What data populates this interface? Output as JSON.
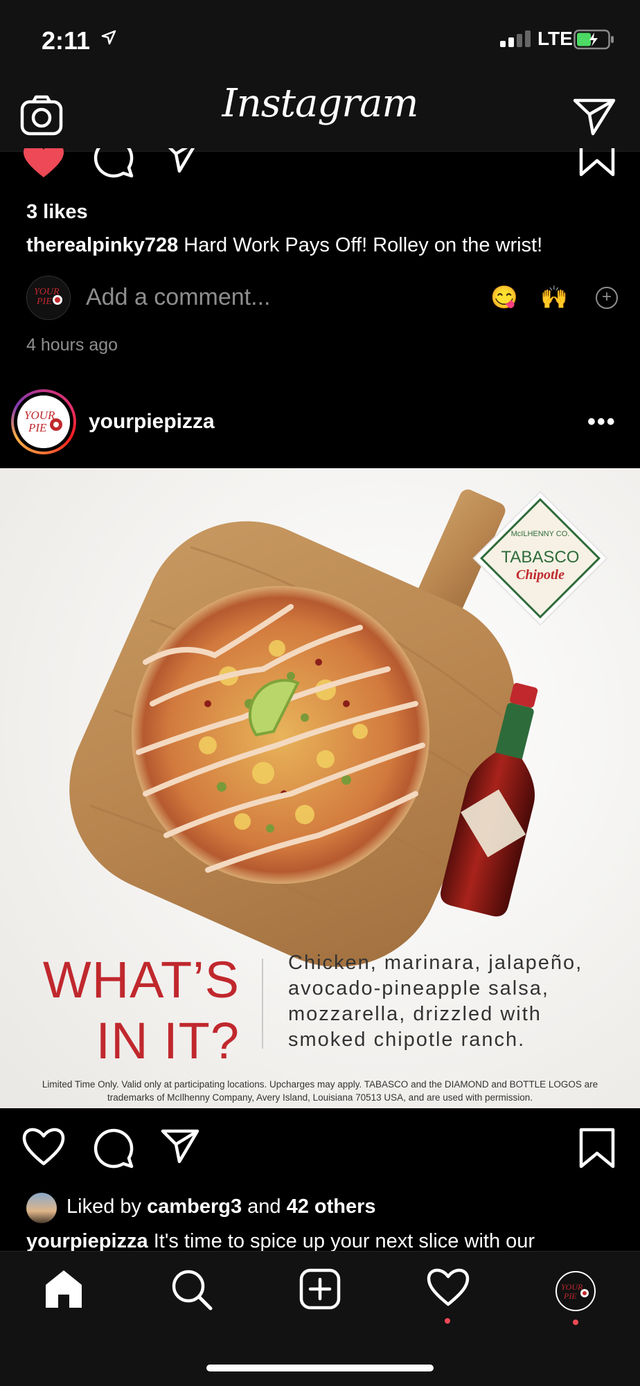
{
  "status": {
    "time": "2:11",
    "network": "LTE"
  },
  "header": {
    "title": "Instagram"
  },
  "prev_post": {
    "likes": "3 likes",
    "username": "therealpinky728",
    "caption": "Hard Work Pays Off! Rolley on the wrist!",
    "comment_placeholder": "Add a comment...",
    "quick_emojis": [
      "😋",
      "🙌"
    ],
    "time_ago": "4 hours ago"
  },
  "post": {
    "username": "yourpiepizza",
    "avatar_text": "YOUR PIE",
    "image": {
      "brand_main": "TABASCO",
      "brand_top": "McILHENNY CO.",
      "brand_sub": "Chipotle",
      "headline_1": "WHAT’S",
      "headline_2": "IN IT?",
      "description": "Chicken, marinara, jalapeño, avocado-pineapple salsa, mozzarella, drizzled with smoked chipotle ranch.",
      "fine_print": "Limited Time Only. Valid only at participating locations. Upcharges may apply. TABASCO and the DIAMOND and BOTTLE LOGOS are trademarks of McIlhenny Company, Avery Island, Louisiana 70513 USA, and are used with permission."
    },
    "liked_by_prefix": "Liked by ",
    "liked_by_user": "camberg3",
    "liked_by_mid": " and ",
    "liked_by_others": "42 others",
    "caption_user": "yourpiepizza",
    "caption_text": "It's time to spice up your next slice with our"
  },
  "tabs": [
    "home-icon",
    "search-icon",
    "new-post-icon",
    "activity-icon",
    "profile-icon"
  ],
  "colors": {
    "like_red": "#ed4956",
    "brand_red": "#c0282d",
    "tabasco_green": "#2e6b3a"
  }
}
